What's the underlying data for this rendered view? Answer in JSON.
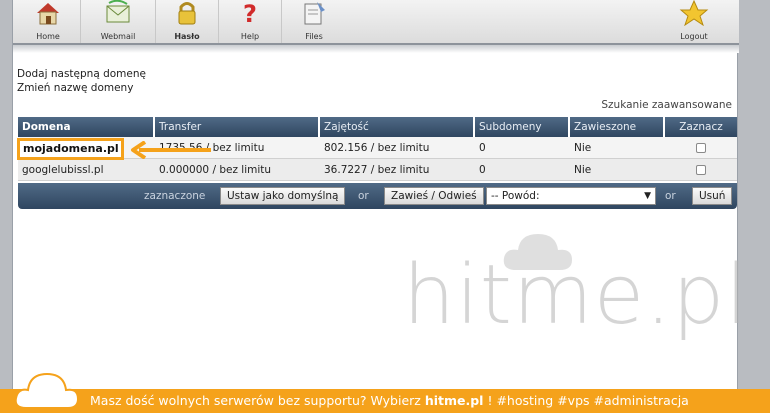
{
  "nav": [
    {
      "label": "Home",
      "icon": "house-icon"
    },
    {
      "label": "Webmail",
      "icon": "envelope-icon"
    },
    {
      "label": "Hasło",
      "icon": "padlock-icon",
      "active": true
    },
    {
      "label": "Help",
      "icon": "question-icon"
    },
    {
      "label": "Files",
      "icon": "files-icon"
    },
    {
      "label": "Logout",
      "icon": "star-icon"
    }
  ],
  "links": {
    "add_domain": "Dodaj następną domenę",
    "rename_domain": "Zmień nazwę domeny"
  },
  "advanced_search": "Szukanie zaawansowane",
  "table": {
    "headers": [
      "Domena",
      "Transfer",
      "Zajętość",
      "Subdomeny",
      "Zawieszone",
      "Zaznacz"
    ],
    "rows": [
      {
        "domain": "mojadomena.pl",
        "transfer": "1735.56 / bez limitu",
        "usage": "802.156 / bez limitu",
        "subdomains": "0",
        "suspended": "Nie"
      },
      {
        "domain": "googlelubissl.pl",
        "transfer": "0.000000 / bez limitu",
        "usage": "36.7227 / bez limitu",
        "subdomains": "0",
        "suspended": "Nie"
      }
    ]
  },
  "actions": {
    "selected_label": "zaznaczone",
    "set_default": "Ustaw jako domyślną",
    "or1": "or",
    "suspend": "Zawieś / Odwieś",
    "reason_placeholder": "-- Powód:",
    "or2": "or",
    "delete": "Usuń"
  },
  "watermark": "hitme.pl",
  "banner": {
    "text_before": "Masz dość wolnych serwerów bez supportu? Wybierz ",
    "brand": "hitme.pl",
    "text_after": " !    #hosting #vps #administracja"
  },
  "colors": {
    "accent": "#f5a21b",
    "header": "#3b536d"
  }
}
